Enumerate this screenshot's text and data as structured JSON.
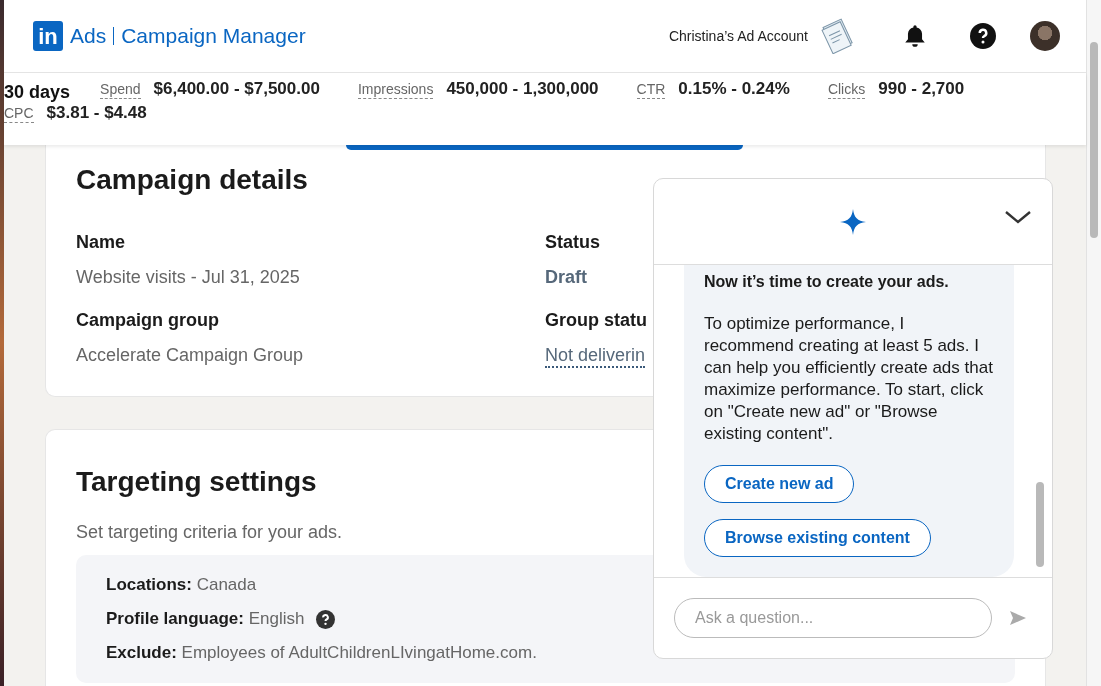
{
  "header": {
    "brand_mark": "in",
    "product": "Ads",
    "app_name": "Campaign Manager",
    "account": "Christina’s Ad Account"
  },
  "stats": {
    "period": "30 days",
    "metrics": [
      {
        "label": "Spend",
        "value": "$6,400.00 - $7,500.00"
      },
      {
        "label": "Impressions",
        "value": "450,000 - 1,300,000"
      },
      {
        "label": "CTR",
        "value": "0.15% - 0.24%"
      },
      {
        "label": "Clicks",
        "value": "990 - 2,700"
      },
      {
        "label": "CPC",
        "value": "$3.81 - $4.48"
      }
    ]
  },
  "campaign_details": {
    "title": "Campaign details",
    "fields": [
      {
        "label": "Name",
        "value": "Website visits - Jul 31, 2025",
        "kind": "plain"
      },
      {
        "label": "Status",
        "value": "Draft",
        "kind": "status"
      },
      {
        "label": "Campaign group",
        "value": "Accelerate Campaign Group",
        "kind": "plain"
      },
      {
        "label": "Group statu",
        "value": "Not deliverin",
        "kind": "link"
      }
    ]
  },
  "targeting": {
    "title": "Targeting settings",
    "subtitle": "Set targeting criteria for your ads.",
    "criteria": [
      {
        "label": "Locations:",
        "value": "Canada",
        "help": false
      },
      {
        "label": "Profile language:",
        "value": "English",
        "help": true
      },
      {
        "label": "Exclude:",
        "value": "Employees of AdultChildrenLIvingatHome.com.",
        "help": false
      }
    ]
  },
  "assistant": {
    "heading": "Now it’s time to create your ads.",
    "message": "To optimize performance, I recommend creating at least 5 ads. I can help you efficiently create ads that maximize performance. To start, click on \"Create new ad\" or \"Browse existing content\".",
    "actions": [
      "Create new ad",
      "Browse existing content"
    ],
    "input": {
      "placeholder": "Ask a question..."
    }
  }
}
